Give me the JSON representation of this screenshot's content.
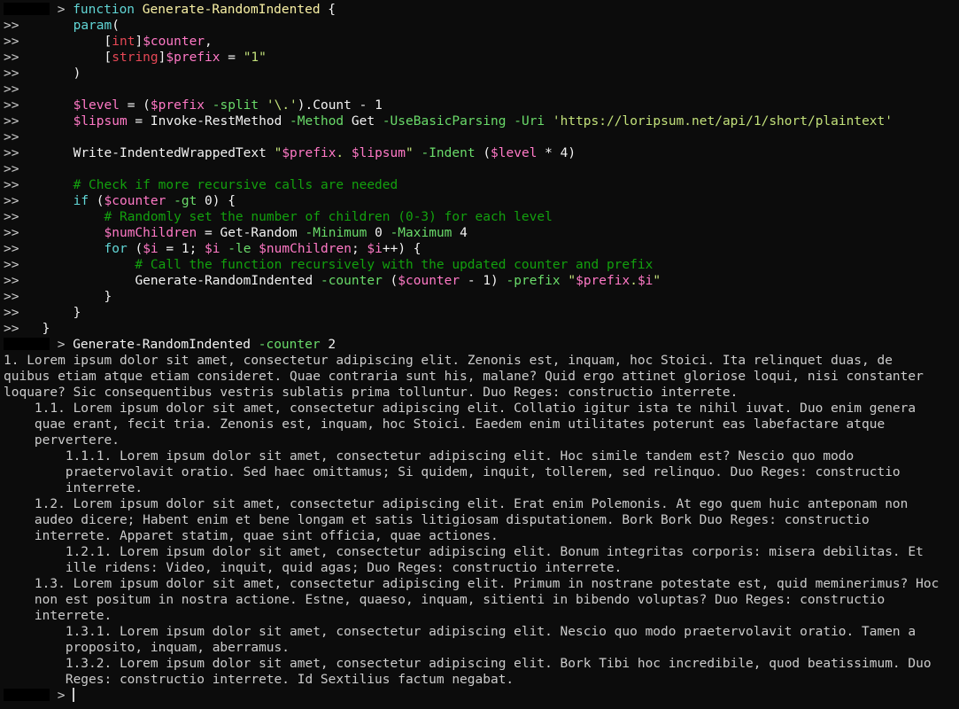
{
  "terminal": {
    "prompt_symbol": ">",
    "continuation": ">>",
    "code_lines": [
      [
        {
          "t": "function ",
          "c": "keyword"
        },
        {
          "t": "Generate-RandomIndented",
          "c": "gold"
        },
        {
          "t": " {",
          "c": "white"
        }
      ],
      [
        {
          "t": "    ",
          "c": "default"
        },
        {
          "t": "param",
          "c": "keyword"
        },
        {
          "t": "(",
          "c": "white"
        }
      ],
      [
        {
          "t": "        [",
          "c": "white"
        },
        {
          "t": "int",
          "c": "typename"
        },
        {
          "t": "]",
          "c": "white"
        },
        {
          "t": "$counter",
          "c": "variable"
        },
        {
          "t": ",",
          "c": "white"
        }
      ],
      [
        {
          "t": "        [",
          "c": "white"
        },
        {
          "t": "string",
          "c": "typename"
        },
        {
          "t": "]",
          "c": "white"
        },
        {
          "t": "$prefix",
          "c": "variable"
        },
        {
          "t": " = ",
          "c": "white"
        },
        {
          "t": "\"1\"",
          "c": "string2"
        }
      ],
      [
        {
          "t": "    )",
          "c": "white"
        }
      ],
      [],
      [
        {
          "t": "    ",
          "c": "default"
        },
        {
          "t": "$level",
          "c": "variable"
        },
        {
          "t": " = (",
          "c": "white"
        },
        {
          "t": "$prefix",
          "c": "variable"
        },
        {
          "t": " -split ",
          "c": "param"
        },
        {
          "t": "'\\.'",
          "c": "string2"
        },
        {
          "t": ").Count - 1",
          "c": "white"
        }
      ],
      [
        {
          "t": "    ",
          "c": "default"
        },
        {
          "t": "$lipsum",
          "c": "variable"
        },
        {
          "t": " = ",
          "c": "white"
        },
        {
          "t": "Invoke-RestMethod",
          "c": "white"
        },
        {
          "t": " -Method ",
          "c": "param"
        },
        {
          "t": "Get",
          "c": "white"
        },
        {
          "t": " -UseBasicParsing -Uri ",
          "c": "param"
        },
        {
          "t": "'https://loripsum.net/api/1/short/plaintext'",
          "c": "string2"
        }
      ],
      [],
      [
        {
          "t": "    ",
          "c": "default"
        },
        {
          "t": "Write-IndentedWrappedText",
          "c": "white"
        },
        {
          "t": " \"",
          "c": "string2"
        },
        {
          "t": "$prefix",
          "c": "variable"
        },
        {
          "t": ". ",
          "c": "string2"
        },
        {
          "t": "$lipsum",
          "c": "variable"
        },
        {
          "t": "\"",
          "c": "string2"
        },
        {
          "t": " -Indent ",
          "c": "param"
        },
        {
          "t": "(",
          "c": "white"
        },
        {
          "t": "$level",
          "c": "variable"
        },
        {
          "t": " * 4)",
          "c": "white"
        }
      ],
      [],
      [
        {
          "t": "    # Check if more recursive calls are needed",
          "c": "comment"
        }
      ],
      [
        {
          "t": "    ",
          "c": "default"
        },
        {
          "t": "if",
          "c": "keyword"
        },
        {
          "t": " (",
          "c": "white"
        },
        {
          "t": "$counter",
          "c": "variable"
        },
        {
          "t": " -gt ",
          "c": "param"
        },
        {
          "t": "0) {",
          "c": "white"
        }
      ],
      [
        {
          "t": "        # Randomly set the number of children (0-3) for each level",
          "c": "comment"
        }
      ],
      [
        {
          "t": "        ",
          "c": "default"
        },
        {
          "t": "$numChildren",
          "c": "variable"
        },
        {
          "t": " = ",
          "c": "white"
        },
        {
          "t": "Get-Random",
          "c": "white"
        },
        {
          "t": " -Minimum ",
          "c": "param"
        },
        {
          "t": "0",
          "c": "white"
        },
        {
          "t": " -Maximum ",
          "c": "param"
        },
        {
          "t": "4",
          "c": "white"
        }
      ],
      [
        {
          "t": "        ",
          "c": "default"
        },
        {
          "t": "for",
          "c": "keyword"
        },
        {
          "t": " (",
          "c": "white"
        },
        {
          "t": "$i",
          "c": "variable"
        },
        {
          "t": " = 1; ",
          "c": "white"
        },
        {
          "t": "$i",
          "c": "variable"
        },
        {
          "t": " -le ",
          "c": "param"
        },
        {
          "t": "$numChildren",
          "c": "variable"
        },
        {
          "t": "; ",
          "c": "white"
        },
        {
          "t": "$i",
          "c": "variable"
        },
        {
          "t": "++) {",
          "c": "white"
        }
      ],
      [
        {
          "t": "            # Call the function recursively with the updated counter and prefix",
          "c": "comment"
        }
      ],
      [
        {
          "t": "            ",
          "c": "default"
        },
        {
          "t": "Generate-RandomIndented",
          "c": "white"
        },
        {
          "t": " -counter ",
          "c": "param"
        },
        {
          "t": "(",
          "c": "white"
        },
        {
          "t": "$counter",
          "c": "variable"
        },
        {
          "t": " - 1)",
          "c": "white"
        },
        {
          "t": " -prefix ",
          "c": "param"
        },
        {
          "t": "\"",
          "c": "string2"
        },
        {
          "t": "$prefix",
          "c": "variable"
        },
        {
          "t": ".",
          "c": "string2"
        },
        {
          "t": "$i",
          "c": "variable"
        },
        {
          "t": "\"",
          "c": "string2"
        }
      ],
      [
        {
          "t": "        }",
          "c": "white"
        }
      ],
      [
        {
          "t": "    }",
          "c": "white"
        }
      ],
      [
        {
          "t": "}",
          "c": "white"
        }
      ]
    ],
    "command_line": [
      {
        "t": "Generate-RandomIndented",
        "c": "white"
      },
      {
        "t": " -counter ",
        "c": "param"
      },
      {
        "t": "2",
        "c": "white"
      }
    ],
    "output_lines": [
      "1. Lorem ipsum dolor sit amet, consectetur adipiscing elit. Zenonis est, inquam, hoc Stoici. Ita relinquet duas, de",
      "quibus etiam atque etiam consideret. Quae contraria sunt his, malane? Quid ergo attinet gloriose loqui, nisi constanter",
      "loquare? Sic consequentibus vestris sublatis prima tolluntur. Duo Reges: constructio interrete.",
      "    1.1. Lorem ipsum dolor sit amet, consectetur adipiscing elit. Collatio igitur ista te nihil iuvat. Duo enim genera",
      "    quae erant, fecit tria. Zenonis est, inquam, hoc Stoici. Eaedem enim utilitates poterunt eas labefactare atque",
      "    pervertere.",
      "        1.1.1. Lorem ipsum dolor sit amet, consectetur adipiscing elit. Hoc simile tandem est? Nescio quo modo",
      "        praetervolavit oratio. Sed haec omittamus; Si quidem, inquit, tollerem, sed relinquo. Duo Reges: constructio",
      "        interrete.",
      "    1.2. Lorem ipsum dolor sit amet, consectetur adipiscing elit. Erat enim Polemonis. At ego quem huic anteponam non",
      "    audeo dicere; Habent enim et bene longam et satis litigiosam disputationem. Bork Bork Duo Reges: constructio",
      "    interrete. Apparet statim, quae sint officia, quae actiones.",
      "        1.2.1. Lorem ipsum dolor sit amet, consectetur adipiscing elit. Bonum integritas corporis: misera debilitas. Et",
      "        ille ridens: Video, inquit, quid agas; Duo Reges: constructio interrete.",
      "    1.3. Lorem ipsum dolor sit amet, consectetur adipiscing elit. Primum in nostrane potestate est, quid meminerimus? Hoc",
      "    non est positum in nostra actione. Estne, quaeso, inquam, sitienti in bibendo voluptas? Duo Reges: constructio",
      "    interrete.",
      "        1.3.1. Lorem ipsum dolor sit amet, consectetur adipiscing elit. Nescio quo modo praetervolavit oratio. Tamen a",
      "        proposito, inquam, aberramus.",
      "        1.3.2. Lorem ipsum dolor sit amet, consectetur adipiscing elit. Bork Tibi hoc incredibile, quod beatissimum. Duo",
      "        Reges: constructio interrete. Id Sextilius factum negabat."
    ]
  }
}
